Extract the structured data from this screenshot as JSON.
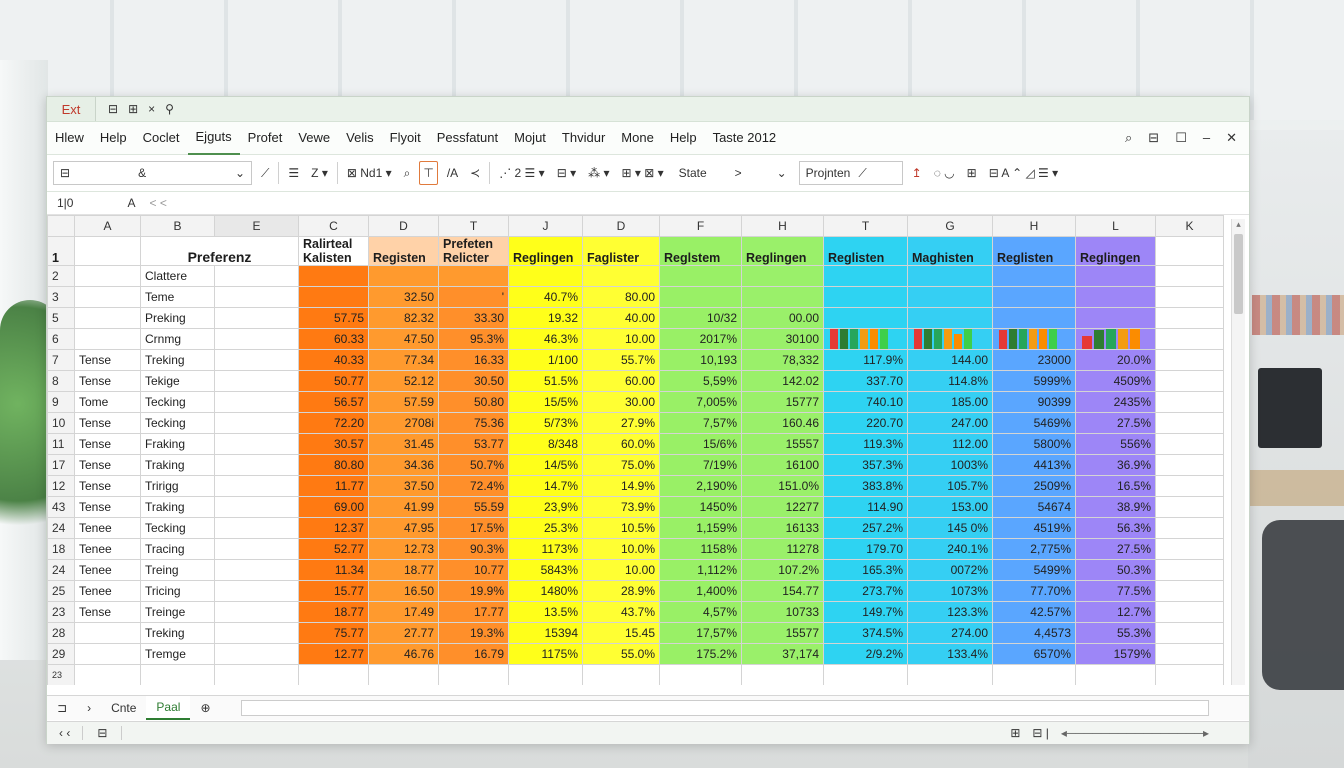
{
  "app": {
    "title_logo": "Ext",
    "qat": [
      "⊟",
      "⊞",
      "×",
      "⚲"
    ]
  },
  "menu": [
    "Hlew",
    "Help",
    "Coclet",
    "Ejguts",
    "Profet",
    "Vewe",
    "Velis",
    "Flyoit",
    "Pessfatunt",
    "Mojut",
    "Thvidur",
    "Mone",
    "Help",
    "Taste 2012"
  ],
  "menu_active_index": 3,
  "window_controls": [
    "⌕",
    "⊟",
    "☐",
    "–",
    "✕"
  ],
  "toolbar": {
    "font_box": "⊟",
    "font_size": "&",
    "items": [
      "☰",
      "Z ▾",
      "⊠ Nd1 ▾",
      "⌕",
      "⊤",
      "/A",
      "≺",
      "⋰ 2 ☰ ▾",
      "⊟ ▾",
      "⁂ ▾",
      "⊞ ▾ ⊠ ▾"
    ],
    "state_label": "State",
    "state_value": ">",
    "project_label": "Projnten",
    "extra": [
      "↥",
      "◌ ◡",
      "⊞",
      "⊟ A ⌃ ◿ ☰ ▾"
    ]
  },
  "formula": {
    "cell_ref": "1|0",
    "value": "A",
    "nav": "< <"
  },
  "columns": [
    "A",
    "B",
    "E",
    "C",
    "D",
    "T",
    "J",
    "D",
    "F",
    "H",
    "T",
    "G",
    "H",
    "L",
    "K"
  ],
  "header_row": {
    "num": "1",
    "b": "Preferenz",
    "c": "Ralirteal Kalisten",
    "d": "Registen",
    "t": "Prefeten Relicter",
    "j": "Reglingen",
    "d2": "Faglister",
    "f": "Reglstem",
    "h": "Reglingen",
    "t2": "Reglisten",
    "g": "Maghisten",
    "h2": "Reglisten",
    "l": "Reglingen"
  },
  "rows": [
    {
      "n": "2",
      "a": "",
      "b": "Clattere",
      "vals": [
        "",
        "",
        "",
        "",
        "",
        "",
        "",
        "",
        "",
        "",
        ""
      ]
    },
    {
      "n": "3",
      "a": "",
      "b": "Teme",
      "vals": [
        "",
        "32.50",
        "'",
        "40.7%",
        "80.00",
        "",
        "",
        "",
        "",
        "",
        ""
      ]
    },
    {
      "n": "5",
      "a": "",
      "b": "Preking",
      "vals": [
        "57.75",
        "82.32",
        "33.30",
        "19.32",
        "40.00",
        "10/32",
        "00.00",
        "",
        "",
        "",
        ""
      ]
    },
    {
      "n": "6",
      "a": "",
      "b": "Crnmg",
      "vals": [
        "60.33",
        "47.50",
        "95.3%",
        "46.3%",
        "10.00",
        "2017%",
        "30100",
        "",
        "",
        "",
        ""
      ]
    },
    {
      "n": "7",
      "a": "Tense",
      "b": "Treking",
      "vals": [
        "40.33",
        "77.34",
        "16.33",
        "1/100",
        "55.7%",
        "10,193",
        "78,332",
        "117.9%",
        "144.00",
        "23000",
        "20.0%"
      ]
    },
    {
      "n": "8",
      "a": "Tense",
      "b": "Tekige",
      "vals": [
        "50.77",
        "52.12",
        "30.50",
        "51.5%",
        "60.00",
        "5,59%",
        "142.02",
        "337.70",
        "114.8%",
        "5999%",
        "4509%"
      ]
    },
    {
      "n": "9",
      "a": "Tome",
      "b": "Tecking",
      "vals": [
        "56.57",
        "57.59",
        "50.80",
        "15/5%",
        "30.00",
        "7,005%",
        "15777",
        "740.10",
        "185.00",
        "90399",
        "2435%"
      ]
    },
    {
      "n": "10",
      "a": "Tense",
      "b": "Tecking",
      "vals": [
        "72.20",
        "2708i",
        "75.36",
        "5/73%",
        "27.9%",
        "7,57%",
        "160.46",
        "220.70",
        "247.00",
        "5469%",
        "27.5%"
      ]
    },
    {
      "n": "11",
      "a": "Tense",
      "b": "Fraking",
      "vals": [
        "30.57",
        "31.45",
        "53.77",
        "8/348",
        "60.0%",
        "15/6%",
        "15557",
        "119.3%",
        "112.00",
        "5800%",
        "556%"
      ]
    },
    {
      "n": "17",
      "a": "Tense",
      "b": "Traking",
      "vals": [
        "80.80",
        "34.36",
        "50.7%",
        "14/5%",
        "75.0%",
        "7/19%",
        "16100",
        "357.3%",
        "1003%",
        "4413%",
        "36.9%"
      ]
    },
    {
      "n": "12",
      "a": "Tense",
      "b": "Tririgg",
      "vals": [
        "11.77",
        "37.50",
        "72.4%",
        "14.7%",
        "14.9%",
        "2,190%",
        "151.0%",
        "383.8%",
        "105.7%",
        "2509%",
        "16.5%"
      ]
    },
    {
      "n": "43",
      "a": "Tense",
      "b": "Traking",
      "vals": [
        "69.00",
        "41.99",
        "55.59",
        "23,9%",
        "73.9%",
        "1450%",
        "12277",
        "114.90",
        "153.00",
        "54674",
        "38.9%"
      ]
    },
    {
      "n": "24",
      "a": "Tenee",
      "b": "Tecking",
      "vals": [
        "12.37",
        "47.95",
        "17.5%",
        "25.3%",
        "10.5%",
        "1,159%",
        "16133",
        "257.2%",
        "145 0%",
        "4519%",
        "56.3%"
      ]
    },
    {
      "n": "18",
      "a": "Tenee",
      "b": "Tracing",
      "vals": [
        "52.77",
        "12.73",
        "90.3%",
        "1173%",
        "10.0%",
        "1158%",
        "11278",
        "179.70",
        "240.1%",
        "2,775%",
        "27.5%"
      ]
    },
    {
      "n": "24",
      "a": "Tenee",
      "b": "Treing",
      "vals": [
        "11.34",
        "18.77",
        "10.77",
        "5843%",
        "10.00",
        "1,112%",
        "107.2%",
        "165.3%",
        "0072%",
        "5499%",
        "50.3%"
      ]
    },
    {
      "n": "25",
      "a": "Tenee",
      "b": "Tricing",
      "vals": [
        "15.77",
        "16.50",
        "19.9%",
        "1480%",
        "28.9%",
        "1,400%",
        "154.77",
        "273.7%",
        "1073%",
        "77.70%",
        "77.5%"
      ]
    },
    {
      "n": "23",
      "a": "Tense",
      "b": "Treinge",
      "vals": [
        "18.77",
        "17.49",
        "17.77",
        "13.5%",
        "43.7%",
        "4,57%",
        "10733",
        "149.7%",
        "123.3%",
        "42.57%",
        "12.7%"
      ]
    },
    {
      "n": "28",
      "a": "",
      "b": "Treking",
      "vals": [
        "75.77",
        "27.77",
        "19.3%",
        "15394",
        "15.45",
        "17,57%",
        "15577",
        "374.5%",
        "274.00",
        "4,4573",
        "55.3%"
      ]
    },
    {
      "n": "29",
      "a": "",
      "b": "Tremge",
      "vals": [
        "12.77",
        "46.76",
        "16.79",
        "1175%",
        "55.0%",
        "175.2%",
        "37,174",
        "2/9.2%",
        "133.4%",
        "6570%",
        "1579%"
      ]
    }
  ],
  "last_row_num": "23",
  "colors": {
    "C": "#ff7a12",
    "D": "#ff9a2e",
    "T": "#ff8f2a",
    "J": "#ffff1a",
    "D2": "#ffff33",
    "F": "#99f066",
    "H": "#9af06a",
    "T2": "#2ed3f2",
    "G": "#35cff3",
    "H2": "#5aa6ff",
    "L": "#9d86f7",
    "hdr_D": "#ffd2a8",
    "hdr_C": "#ffffff"
  },
  "mini_charts": {
    "h_col": [
      3,
      2,
      5,
      2
    ],
    "t2_col": [
      3,
      2,
      4,
      3,
      5,
      3
    ],
    "g_col": [
      5,
      6,
      8,
      3,
      2,
      4
    ],
    "h2_col": [
      2,
      3,
      5,
      6,
      3,
      5
    ],
    "l_col": [
      2,
      3,
      4,
      6,
      9
    ]
  },
  "sheets": {
    "nav": [
      "⊐",
      "›"
    ],
    "tabs": [
      "Cnte",
      "Paal"
    ],
    "active": 1,
    "add": "⊕"
  },
  "status": {
    "left": "‹ ‹",
    "view": "⊟",
    "mid": "⊞",
    "right": "⊟ |",
    "zoom": "◂────────────────▸"
  }
}
